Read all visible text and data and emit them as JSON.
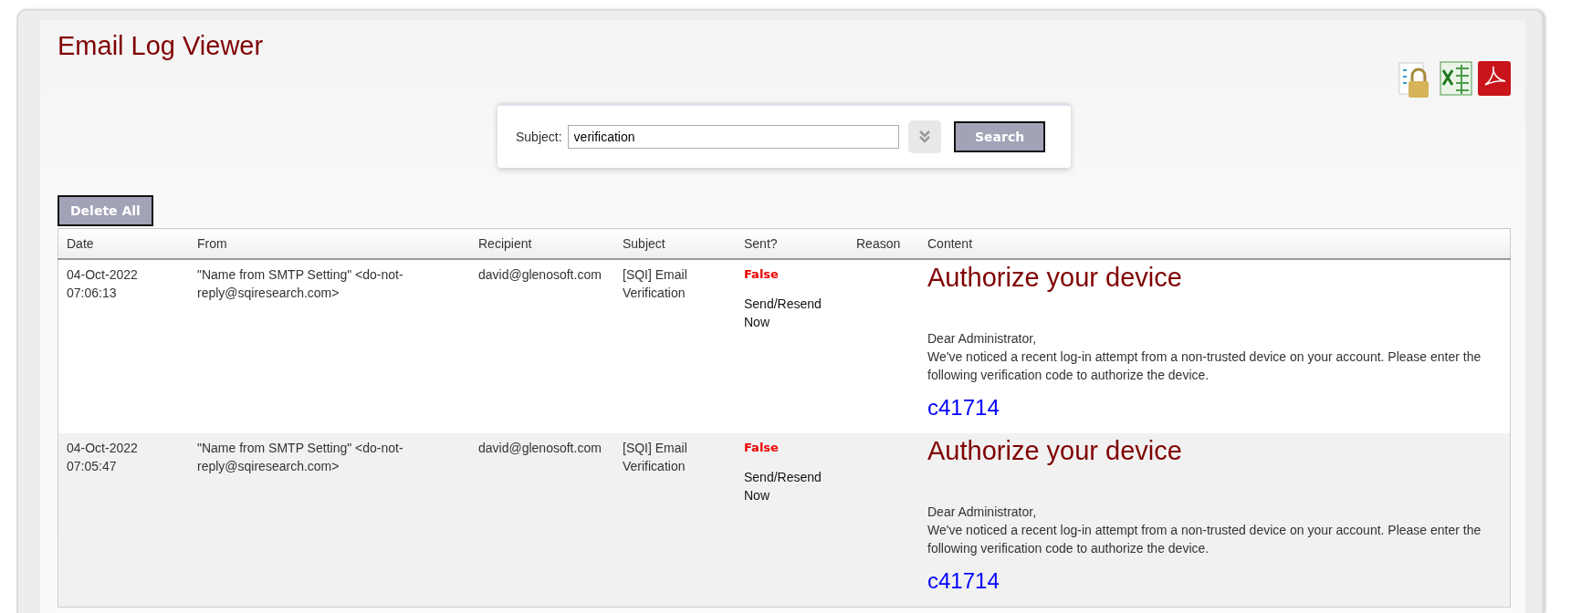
{
  "title": "Email Log Viewer",
  "search": {
    "label": "Subject:",
    "value": "verification",
    "button": "Search"
  },
  "delete_button": "Delete All",
  "table": {
    "columns": [
      "Date",
      "From",
      "Recipient",
      "Subject",
      "Sent?",
      "Reason",
      "Content"
    ],
    "rows": [
      {
        "date": "04-Oct-2022\n07:06:13",
        "from": "\"Name from SMTP Setting\" <do-not-reply@sqiresearch.com>",
        "recipient": "david@glenosoft.com",
        "subject": "[SQI] Email Verification",
        "sent": "False",
        "action": "Send/Resend Now",
        "content": {
          "heading": "Authorize your device",
          "greeting": "Dear Administrator,",
          "body": "We've noticed a recent log-in attempt from a non-trusted device on your account. Please enter the following verification code to authorize the device.",
          "code": "c41714"
        }
      },
      {
        "date": "04-Oct-2022\n07:05:47",
        "from": "\"Name from SMTP Setting\" <do-not-reply@sqiresearch.com>",
        "recipient": "david@glenosoft.com",
        "subject": "[SQI] Email Verification",
        "sent": "False",
        "action": "Send/Resend Now",
        "content": {
          "heading": "Authorize your device",
          "greeting": "Dear Administrator,",
          "body": "We've noticed a recent log-in attempt from a non-trusted device on your account. Please enter the following verification code to authorize the device.",
          "code": "c41714"
        }
      }
    ]
  }
}
